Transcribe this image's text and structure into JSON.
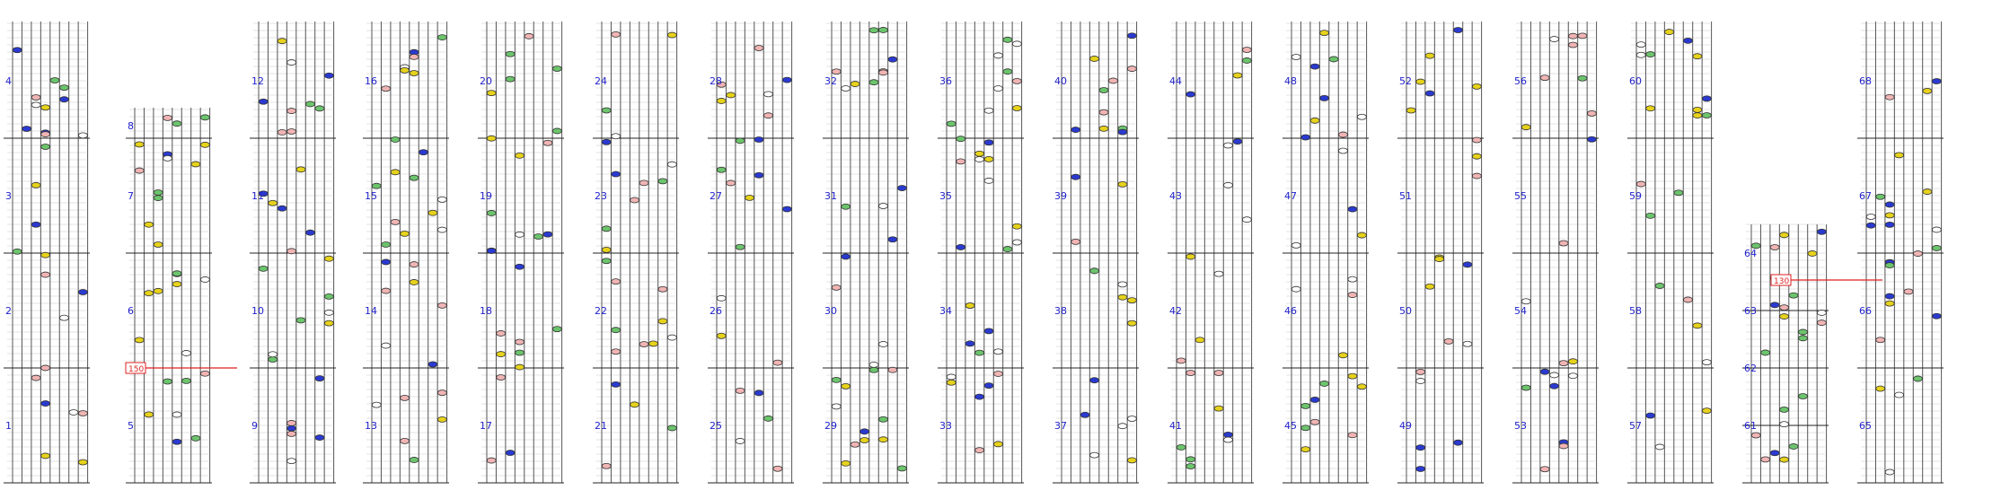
{
  "colors": {
    "background": "#ffffff",
    "lane": "#555555",
    "grid": "#c8c8c8",
    "beat": "#222222",
    "measure_label": "#2222cc",
    "tempo": "#dd2222",
    "note_white": "#ffffff",
    "note_yellow": "#e6d21c",
    "note_green": "#6cc46c",
    "note_blue": "#2a3ad0",
    "note_red": "#f0b4b4"
  },
  "measure_labels": [
    "1",
    "2",
    "3",
    "4",
    "5",
    "6",
    "7",
    "8",
    "9",
    "10",
    "11",
    "12",
    "13",
    "14",
    "15",
    "16",
    "17",
    "18",
    "19",
    "20",
    "21",
    "22",
    "23",
    "24",
    "25",
    "26",
    "27",
    "28",
    "29",
    "30",
    "31",
    "32",
    "33",
    "34",
    "35",
    "36",
    "37",
    "38",
    "39",
    "40",
    "41",
    "42",
    "43",
    "44",
    "45",
    "46",
    "47",
    "48",
    "49",
    "50",
    "51",
    "52",
    "53",
    "54",
    "55",
    "56",
    "57",
    "58",
    "59",
    "60",
    "61",
    "62",
    "63",
    "64",
    "65",
    "66",
    "67",
    "68"
  ],
  "tempo_marks": [
    "150",
    "130"
  ]
}
